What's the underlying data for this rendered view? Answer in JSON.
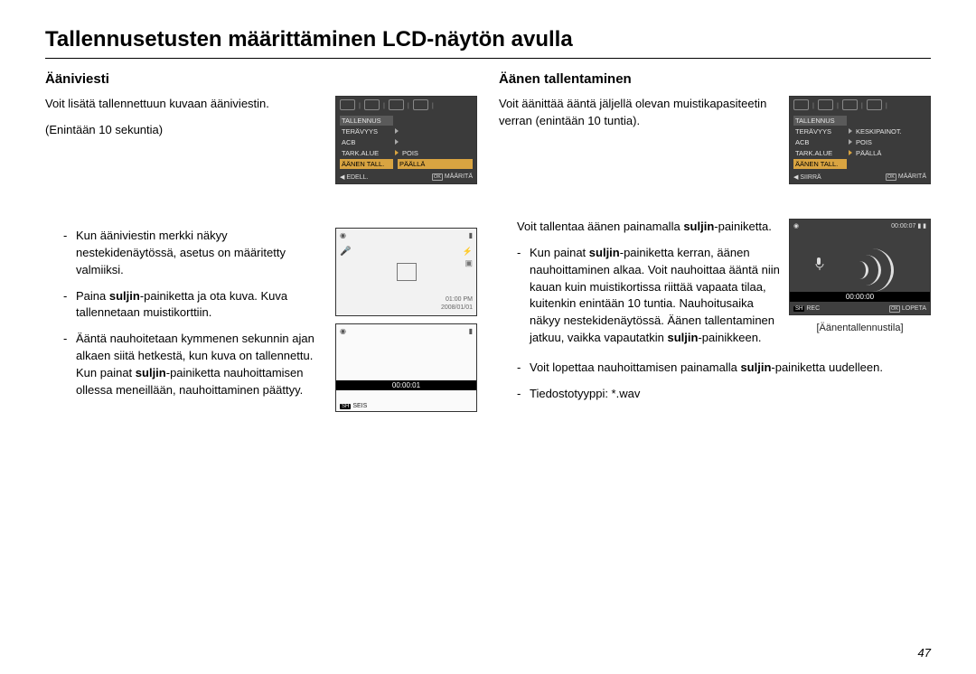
{
  "page": {
    "main_title": "Tallennusetusten määrittäminen LCD-näytön avulla",
    "number": "47"
  },
  "left": {
    "heading": "Ääniviesti",
    "intro_line1": "Voit lisätä tallennettuun kuvaan ääniviestin.",
    "intro_line2": "(Enintään 10 sekuntia)",
    "b1": "Kun ääniviestin merkki näkyy nestekidenäytössä, asetus on määritetty valmiiksi.",
    "b2_a": "Paina ",
    "b2_bold": "suljin",
    "b2_b": "-painiketta ja ota kuva.  Kuva tallennetaan muistikorttiin.",
    "b3_a": "Ääntä nauhoitetaan kymmenen sekunnin ajan alkaen siitä hetkestä, kun kuva on tallennettu. Kun painat ",
    "b3_bold": "suljin",
    "b3_b": "-painiketta nauhoittamisen ollessa meneillään, nauhoittaminen päättyy."
  },
  "right": {
    "heading": "Äänen tallentaminen",
    "intro": "Voit äänittää ääntä jäljellä olevan muistikapasiteetin verran (enintään 10 tuntia).",
    "sub_intro_a": "Voit tallentaa äänen painamalla ",
    "sub_intro_bold": "suljin",
    "sub_intro_b": "-painiketta.",
    "b1_a": "Kun painat ",
    "b1_bold1": "suljin",
    "b1_b": "-painiketta kerran, äänen nauhoittaminen alkaa. Voit nauhoittaa ääntä niin kauan kuin muistikortissa riittää vapaata tilaa, kuitenkin enintään 10 tuntia.  Nauhoi­tusaika näkyy nestekidenäytössä.  Äänen tallentaminen jatkuu, vaikka vapautatkin ",
    "b1_bold2": "suljin",
    "b1_c": "-painikkeen.",
    "b2_a": "Voit lopettaa nauhoittamisen painamalla ",
    "b2_bold": "suljin",
    "b2_b": "-painiketta uudelleen.",
    "b3": "Tiedostotyyppi:  *.wav"
  },
  "menu1": {
    "section": "TALLENNUS",
    "i1": "TERÄVYYS",
    "i2": "ACB",
    "i3": "TARK.ALUE",
    "i4_sel": "ÄÄNEN TALL.",
    "opt_off": "POIS",
    "opt_on_sel": "PÄÄLLÄ",
    "back": "EDELL.",
    "ok": "OK",
    "set": "MÄÄRITÄ"
  },
  "preview": {
    "time": "01:00 PM",
    "date": "2008/01/01"
  },
  "rec": {
    "timer": "00:00:01",
    "sh": "SH",
    "stop": "SEIS"
  },
  "menu2": {
    "section": "TALLENNUS",
    "i1": "TERÄVYYS",
    "i2": "ACB",
    "i3": "TARK.ALUE",
    "i4_sel": "ÄÄNEN TALL.",
    "r1": "KESKIPAINOT.",
    "r2": "POIS",
    "r3": "PÄÄLLÄ",
    "move": "SIIRRÄ",
    "ok": "OK",
    "set": "MÄÄRITÄ"
  },
  "recvis": {
    "top_time": "00:00:07",
    "timer": "00:00:00",
    "sh": "SH",
    "rec_label": "REC",
    "ok": "OK",
    "stop": "LOPETA",
    "caption": "[Äänentallennustila]"
  }
}
